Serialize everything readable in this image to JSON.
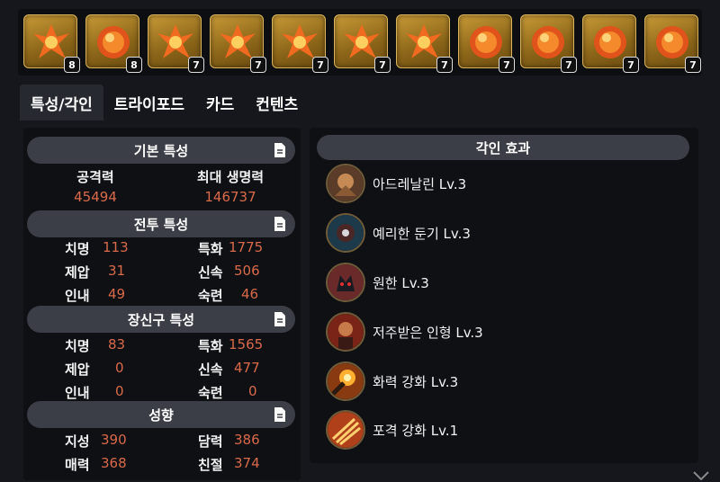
{
  "gems": [
    {
      "type": "attack",
      "count": "8"
    },
    {
      "type": "cooldown",
      "count": "8"
    },
    {
      "type": "attack",
      "count": "7"
    },
    {
      "type": "attack",
      "count": "7"
    },
    {
      "type": "attack",
      "count": "7"
    },
    {
      "type": "attack",
      "count": "7"
    },
    {
      "type": "attack",
      "count": "7"
    },
    {
      "type": "cooldown",
      "count": "7"
    },
    {
      "type": "cooldown",
      "count": "7"
    },
    {
      "type": "cooldown",
      "count": "7"
    },
    {
      "type": "cooldown",
      "count": "7"
    }
  ],
  "tabs": [
    "특성/각인",
    "트라이포드",
    "카드",
    "컨텐츠"
  ],
  "basic": {
    "title": "기본 특성",
    "attack_label": "공격력",
    "attack_value": "45494",
    "hp_label": "최대 생명력",
    "hp_value": "146737"
  },
  "combat": {
    "title": "전투 특성",
    "crit_label": "치명",
    "crit": "113",
    "spec_label": "특화",
    "spec": "1775",
    "dom_label": "제압",
    "dom": "31",
    "swift_label": "신속",
    "swift": "506",
    "endu_label": "인내",
    "endu": "49",
    "exp_label": "숙련",
    "exp": "46"
  },
  "accessory": {
    "title": "장신구 특성",
    "crit_label": "치명",
    "crit": "83",
    "spec_label": "특화",
    "spec": "1565",
    "dom_label": "제압",
    "dom": "0",
    "swift_label": "신속",
    "swift": "477",
    "endu_label": "인내",
    "endu": "0",
    "exp_label": "숙련",
    "exp": "0"
  },
  "tendency": {
    "title": "성향",
    "int_label": "지성",
    "int": "390",
    "courage_label": "담력",
    "courage": "386",
    "charm_label": "매력",
    "charm": "368",
    "kind_label": "친절",
    "kind": "374"
  },
  "engravings": {
    "title": "각인 효과",
    "items": [
      {
        "name": "아드레날린 Lv.3"
      },
      {
        "name": "예리한 둔기 Lv.3"
      },
      {
        "name": "원한 Lv.3"
      },
      {
        "name": "저주받은 인형 Lv.3"
      },
      {
        "name": "화력 강화 Lv.3"
      },
      {
        "name": "포격 강화 Lv.1"
      }
    ]
  },
  "colors": {
    "accent_value": "#d96a4a",
    "header_bg": "#3b3e46",
    "gem_gold": "#c89a36"
  }
}
